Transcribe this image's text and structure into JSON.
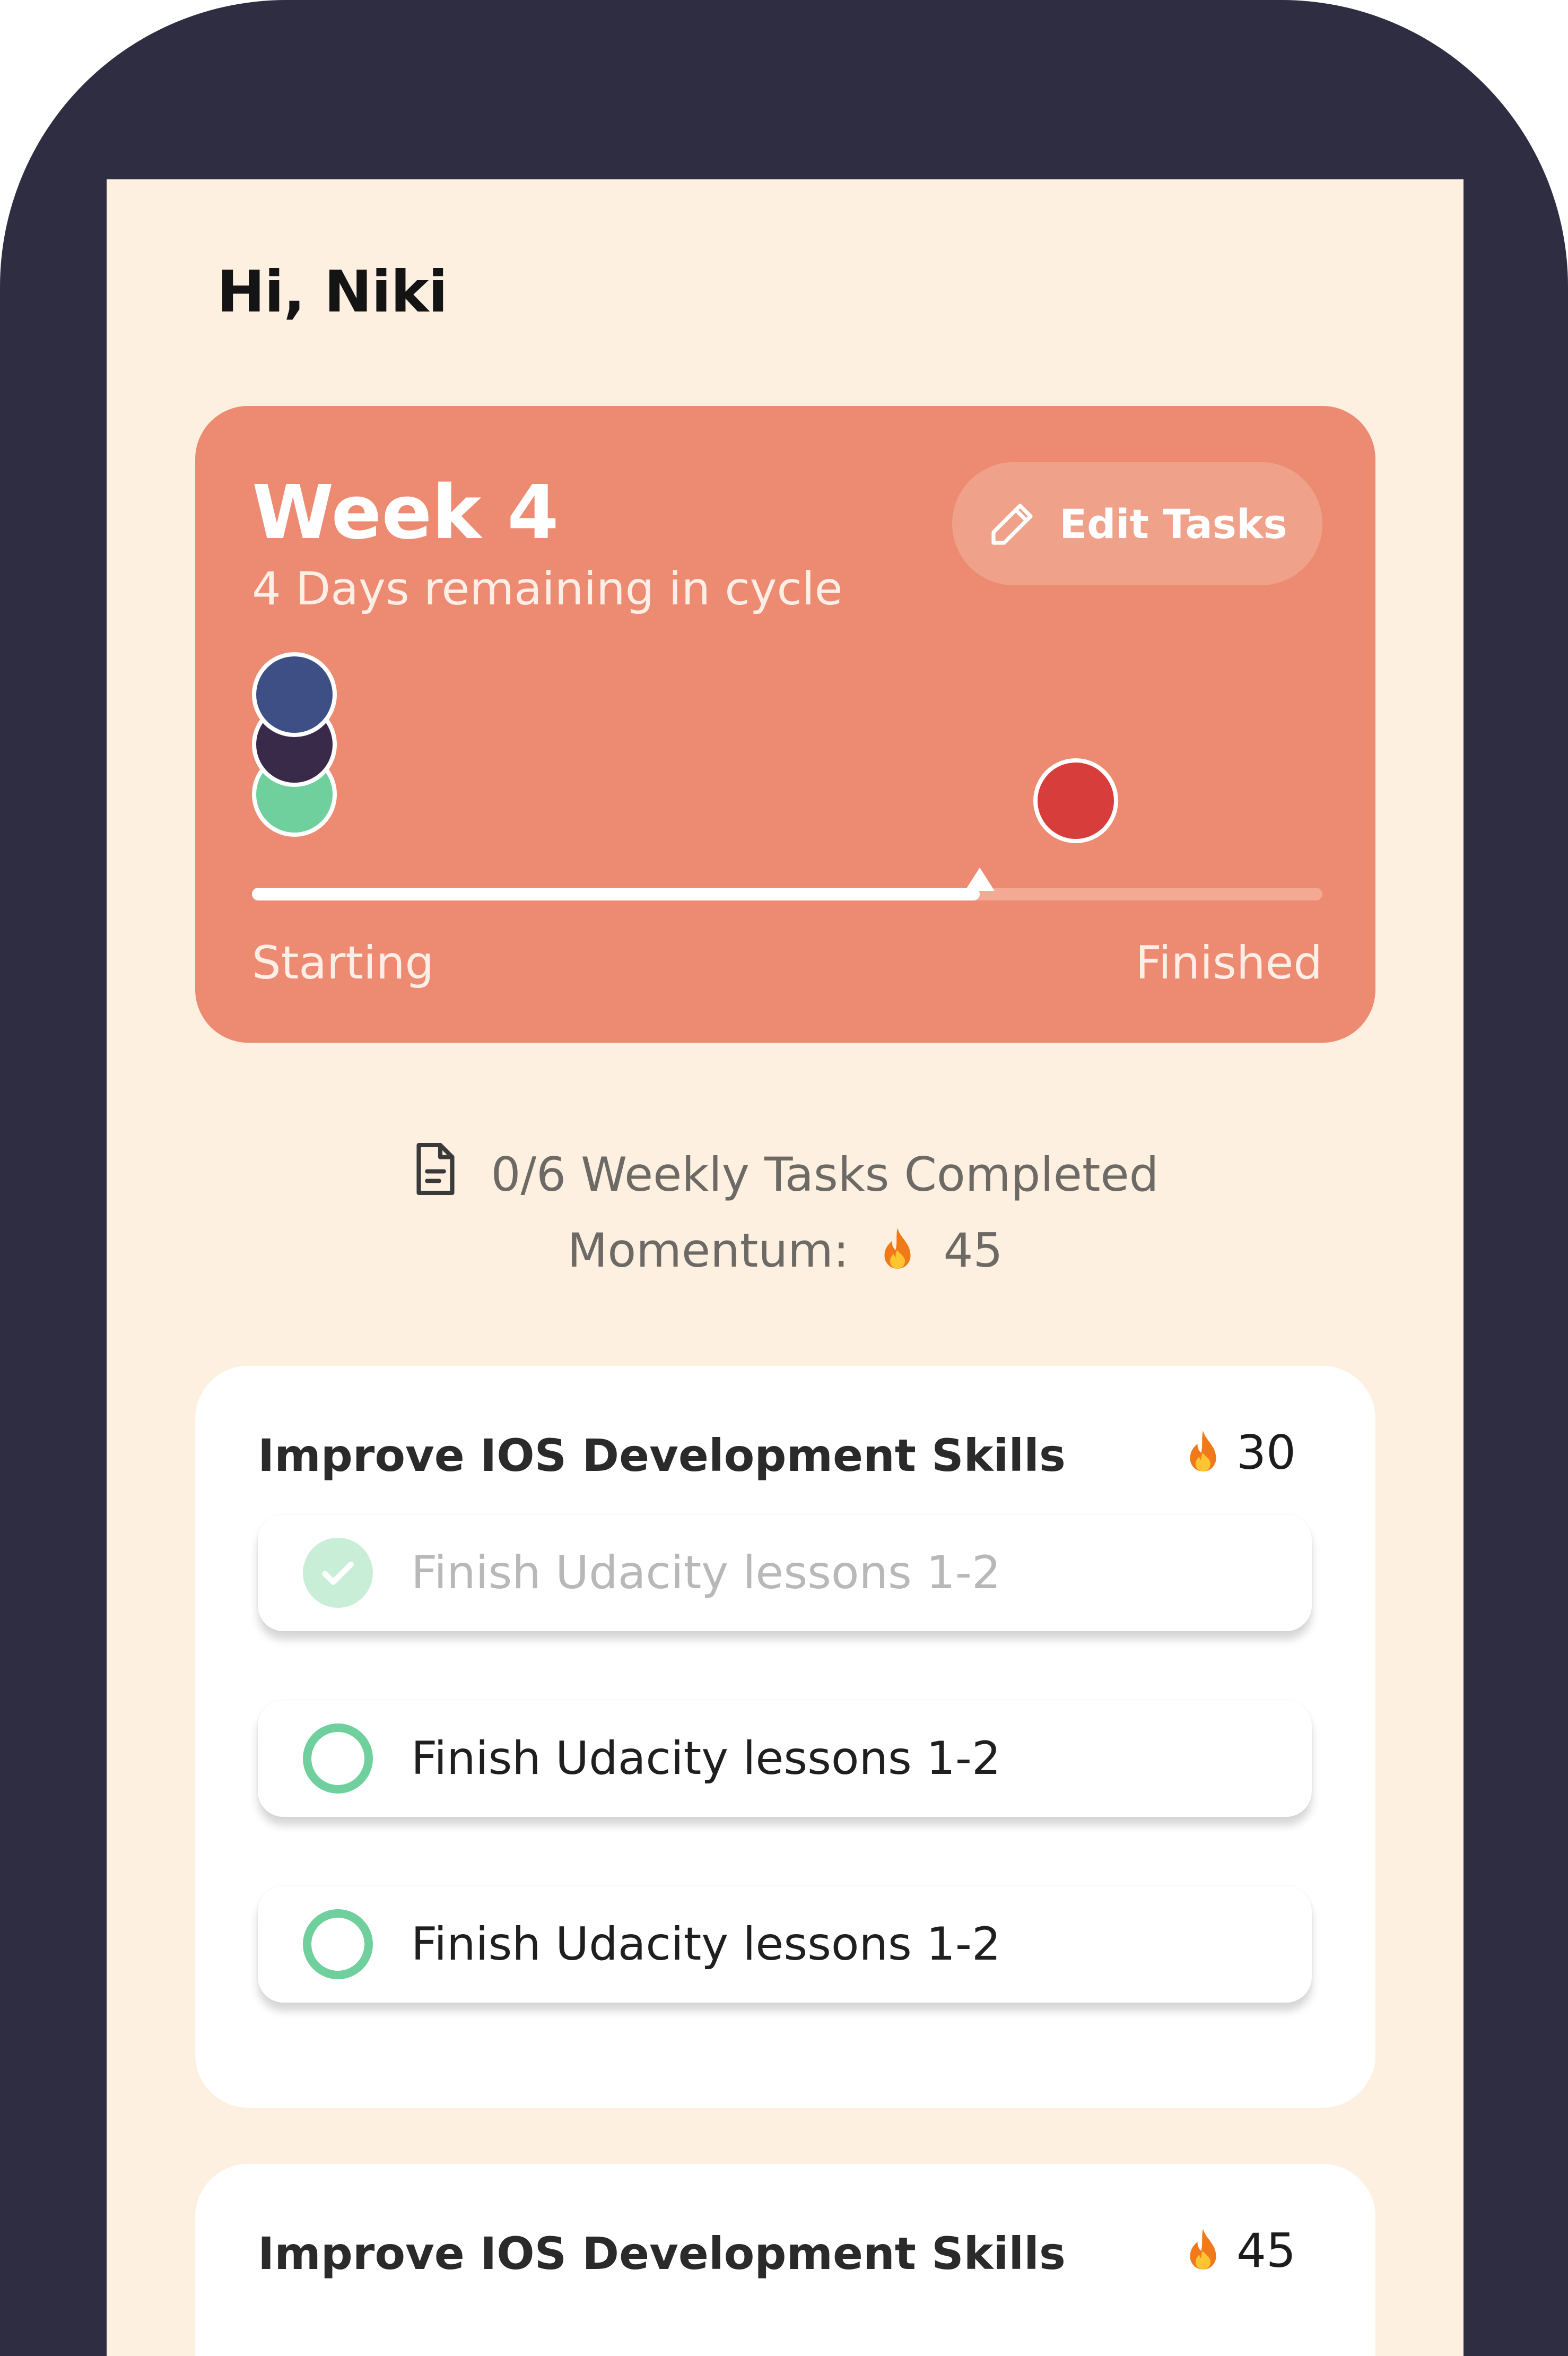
{
  "greeting": "Hi, Niki",
  "cycle": {
    "title": "Week 4",
    "subtitle": "4 Days remaining in cycle",
    "edit_button_label": "Edit Tasks",
    "start_label": "Starting",
    "end_label": "Finished",
    "progress_fraction": 0.68,
    "colors": {
      "card": "#ec8b72",
      "dot_navy": "#3e4f85",
      "dot_plum": "#382a48",
      "dot_green": "#6fcf9d",
      "dot_red": "#d63d3b"
    }
  },
  "summary": {
    "tasks_text": "0/6 Weekly Tasks Completed",
    "momentum_label": "Momentum:",
    "momentum_value": "45"
  },
  "goals": [
    {
      "title": "Improve IOS Development Skills",
      "score": "30",
      "tasks": [
        {
          "label": "Finish Udacity lessons 1-2",
          "done": true
        },
        {
          "label": "Finish Udacity lessons 1-2",
          "done": false
        },
        {
          "label": "Finish Udacity lessons 1-2",
          "done": false
        }
      ]
    },
    {
      "title": "Improve IOS Development Skills",
      "score": "45",
      "tasks": []
    }
  ],
  "icons": {
    "edit": "pencil-icon",
    "summary": "document-icon",
    "momentum": "flame-icon",
    "done": "check-circle-icon",
    "open": "empty-circle-icon"
  }
}
